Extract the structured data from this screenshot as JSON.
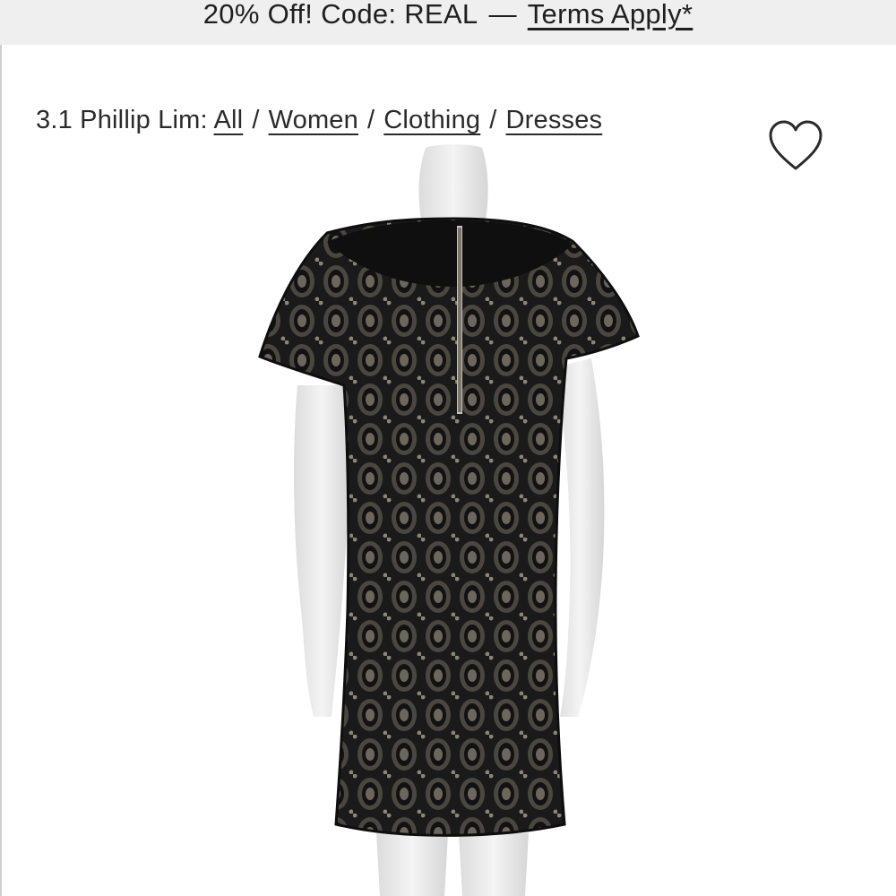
{
  "promo": {
    "text": "20% Off! Code: REAL",
    "separator": "—",
    "terms_link": "Terms Apply*"
  },
  "breadcrumb": {
    "brand": "3.1 Phillip Lim:",
    "separator": "/",
    "items": [
      {
        "label": "All"
      },
      {
        "label": "Women"
      },
      {
        "label": "Clothing"
      },
      {
        "label": "Dresses"
      }
    ]
  },
  "favorite": {
    "icon": "heart-icon"
  },
  "product": {
    "image_description_icon": "product-photo"
  },
  "colors": {
    "promo_bg": "#efefef",
    "text": "#222222",
    "dress": "#141414",
    "mannequin": "#e9e9e9"
  }
}
